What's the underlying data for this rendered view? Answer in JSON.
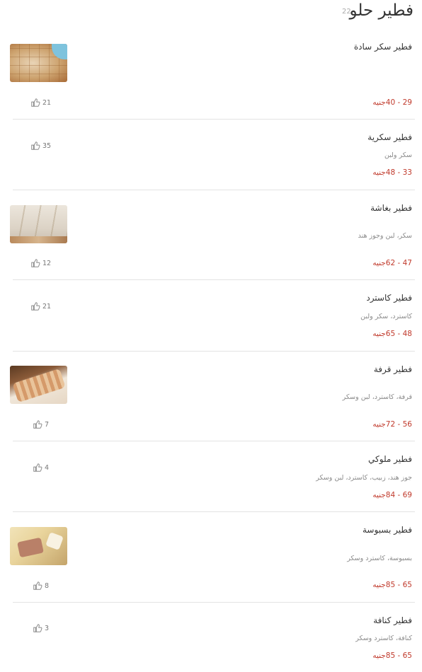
{
  "category": {
    "title": "فطير حلو",
    "count": "22"
  },
  "icons": {
    "like": "thumbs-up-icon"
  },
  "colors": {
    "price": "#c0392b",
    "separator": "#e3e3e3"
  },
  "items": [
    {
      "name": "فطير سكر سادة",
      "description": "",
      "price": "29 - 40جنيه",
      "likes": "21",
      "image": "plain-sugar-pie"
    },
    {
      "name": "فطير سكرية",
      "description": "سكر ولبن",
      "price": "33 - 48جنيه",
      "likes": "35",
      "image": ""
    },
    {
      "name": "فطير بغاشة",
      "description": "سكر، لبن وجوز هند",
      "price": "47 - 62جنيه",
      "likes": "12",
      "image": "baghasha-pie"
    },
    {
      "name": "فطير كاسترد",
      "description": "كاسترد، سكر ولبن",
      "price": "48 - 65جنيه",
      "likes": "21",
      "image": ""
    },
    {
      "name": "فطير قرفة",
      "description": "قرفة، كاسترد، لبن وسكر",
      "price": "56 - 72جنيه",
      "likes": "7",
      "image": "cinnamon-pie"
    },
    {
      "name": "فطير ملوكي",
      "description": "جوز هند، زبيب، كاسترد، لبن وسكر",
      "price": "69 - 84جنيه",
      "likes": "4",
      "image": ""
    },
    {
      "name": "فطير بسبوسة",
      "description": "بسبوسة، كاسترد وسكر",
      "price": "65 - 85جنيه",
      "likes": "8",
      "image": "basbousa-pie"
    },
    {
      "name": "فطير كنافة",
      "description": "كنافة، كاسترد وسكر",
      "price": "65 - 85جنيه",
      "likes": "3",
      "image": ""
    }
  ]
}
